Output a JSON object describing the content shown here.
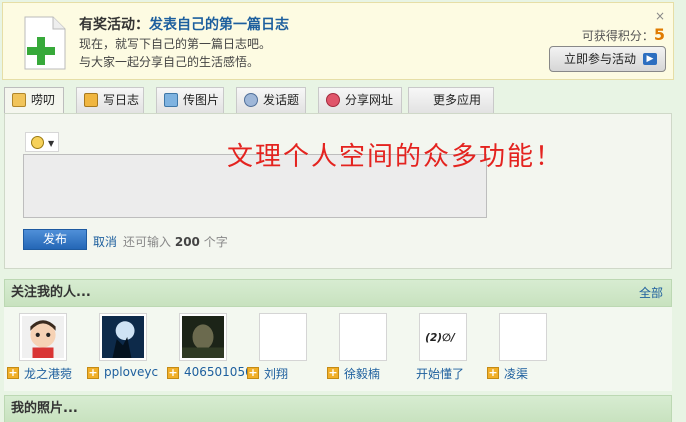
{
  "promo": {
    "label": "有奖活动：",
    "link": "发表自己的第一篇日志",
    "line1": "现在，就写下自己的第一篇日志吧。",
    "line2": "与大家一起分享自己的生活感悟。",
    "close": "×",
    "points_label": "可获得积分：",
    "points_value": "5",
    "button_label": "立即参与活动"
  },
  "tabs": [
    {
      "label": "唠叨"
    },
    {
      "label": "写日志"
    },
    {
      "label": "传图片"
    },
    {
      "label": "发话题"
    },
    {
      "label": "分享网址"
    },
    {
      "label": "更多应用"
    }
  ],
  "compose": {
    "overlay_text": "文理个人空间的众多功能！",
    "textarea_value": "",
    "publish_label": "发布",
    "cancel_label": "取消",
    "remaining_prefix": "还可输入",
    "remaining_count": "200",
    "remaining_suffix": "个字"
  },
  "followers_section": {
    "title": "关注我的人...",
    "all_link": "全部",
    "items": [
      {
        "name": "龙之港菀",
        "has_add": true
      },
      {
        "name": "pploveyc",
        "has_add": true
      },
      {
        "name": "406501050",
        "has_add": true
      },
      {
        "name": "刘翔",
        "has_add": true
      },
      {
        "name": "徐毅楠",
        "has_add": true
      },
      {
        "name": "开始懂了",
        "has_add": false
      },
      {
        "name": "凌渠",
        "has_add": true
      }
    ]
  },
  "photos_section": {
    "title": "我的照片..."
  },
  "colors": {
    "link": "#1d5f9e",
    "points": "#e07b00",
    "overlay_text": "#e4231f",
    "section_bg": "#c8e2bf"
  }
}
